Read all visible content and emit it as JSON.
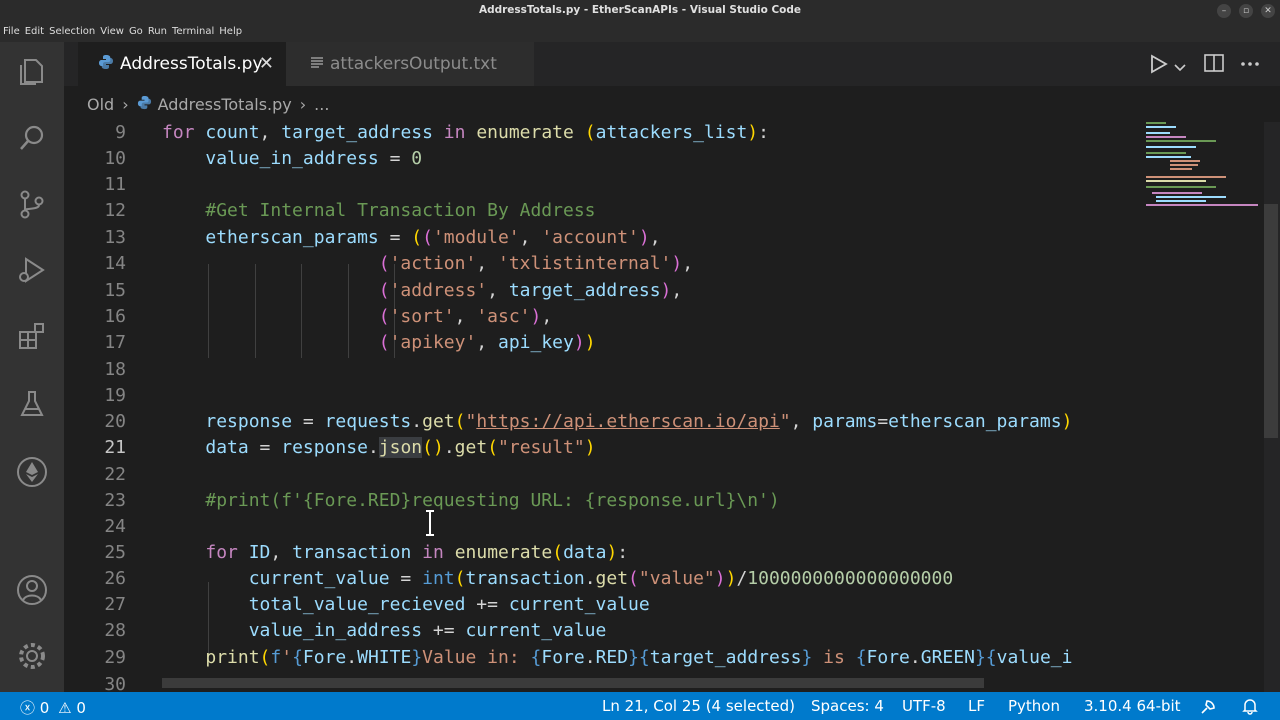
{
  "window": {
    "title": "AddressTotals.py - EtherScanAPIs - Visual Studio Code"
  },
  "menu": [
    "File",
    "Edit",
    "Selection",
    "View",
    "Go",
    "Run",
    "Terminal",
    "Help"
  ],
  "tabs": {
    "active_label": "AddressTotals.py",
    "inactive_label": "attackersOutput.txt"
  },
  "breadcrumb": {
    "folder": "Old",
    "file": "AddressTotals.py",
    "more": "..."
  },
  "line_numbers": [
    "9",
    "10",
    "11",
    "12",
    "13",
    "14",
    "15",
    "16",
    "17",
    "18",
    "19",
    "20",
    "21",
    "22",
    "23",
    "24",
    "25",
    "26",
    "27",
    "28",
    "29",
    "30"
  ],
  "status": {
    "errors": "0",
    "warnings": "0",
    "position": "Ln 21, Col 25 (4 selected)",
    "spaces": "Spaces: 4",
    "encoding": "UTF-8",
    "eol": "LF",
    "language": "Python",
    "interpreter": "3.10.4 64-bit"
  },
  "colors": {
    "status_bar": "#007acc",
    "editor_bg": "#1e1e1e",
    "activity_bar": "#333333",
    "keyword": "#c586c0",
    "function": "#dcdcaa",
    "variable": "#9cdcfe",
    "string": "#ce9178",
    "comment": "#6a9955"
  },
  "icons": {
    "activity": [
      "explorer-icon",
      "search-icon",
      "source-control-icon",
      "run-debug-icon",
      "extensions-icon",
      "testing-icon",
      "ethereum-icon",
      "account-icon",
      "settings-gear-icon"
    ],
    "editor_actions": [
      "run-icon",
      "chevron-down-icon",
      "split-editor-icon",
      "more-actions-icon"
    ]
  }
}
